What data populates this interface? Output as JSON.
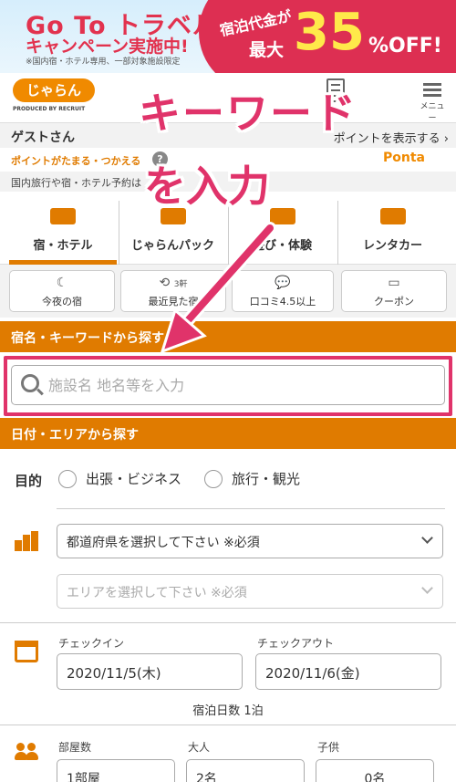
{
  "banner": {
    "title": "Go To トラベル",
    "subtitle": "キャンペーン実施中!",
    "note": "※国内宿・ホテル専用、一部対象施設限定",
    "promo_line1": "宿泊代金が",
    "promo_line2": "最大",
    "promo_percent": "35",
    "promo_off": "%OFF!"
  },
  "header": {
    "logo": "じゃらん",
    "produced_by": "PRODUCED BY RECRUIT",
    "menu_label": "メニュー"
  },
  "guest": {
    "name": "ゲストさん",
    "points_link": "ポイントを表示する ›"
  },
  "points": {
    "text": "ポイントがたまる・つかえる",
    "help": "?",
    "brand": "Ponta"
  },
  "domestic": {
    "text": "国内旅行や宿・ホテル予約は"
  },
  "categories": [
    {
      "label": "宿・ホテル"
    },
    {
      "label": "じゃらんパック"
    },
    {
      "label": "遊び・体験"
    },
    {
      "label": "レンタカー"
    }
  ],
  "quick": [
    {
      "label": "今夜の宿",
      "icon": "moon-icon"
    },
    {
      "label": "最近見た宿",
      "badge": "3軒",
      "icon": "history-icon"
    },
    {
      "label": "口コミ4.5以上",
      "icon": "chat-icon"
    },
    {
      "label": "クーポン",
      "icon": "coupon-icon"
    }
  ],
  "keyword_section": {
    "header": "宿名・キーワードから探す",
    "placeholder": "施設名 地名等を入力"
  },
  "area_section": {
    "header": "日付・エリアから探す",
    "purpose_label": "目的",
    "purpose_options": [
      "出張・ビジネス",
      "旅行・観光"
    ],
    "prefecture_placeholder": "都道府県を選択して下さい ※必須",
    "area_placeholder": "エリアを選択して下さい ※必須",
    "checkin_label": "チェックイン",
    "checkout_label": "チェックアウト",
    "checkin_value": "2020/11/5(木)",
    "checkout_value": "2020/11/6(金)",
    "nights": "宿泊日数 1泊",
    "rooms_label": "部屋数",
    "adults_label": "大人",
    "children_label": "子供",
    "rooms_value": "1部屋",
    "adults_value": "2名",
    "children_value": "0名"
  },
  "annotation": {
    "line1": "キーワード",
    "line2": "を入力",
    "color": "#e0336a"
  },
  "colors": {
    "accent": "#e07b00",
    "banner_red": "#dd2f52",
    "highlight": "#e0336a"
  }
}
